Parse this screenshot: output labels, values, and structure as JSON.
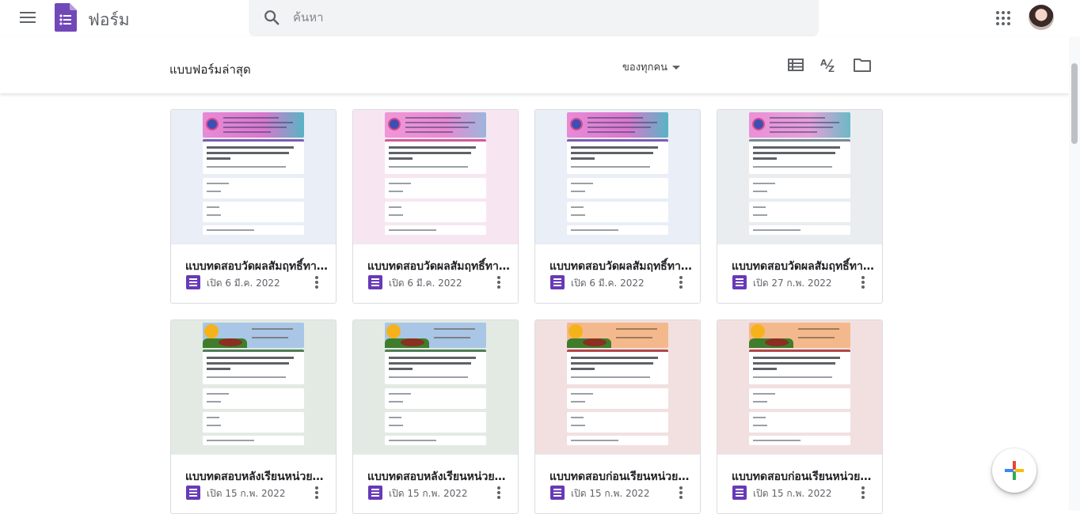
{
  "topbar": {
    "app_name": "ฟอร์ม",
    "menu_icon": "hamburger-menu-icon",
    "logo_icon": "google-forms-logo",
    "search_placeholder": "ค้นหา",
    "search_value": "",
    "apps_icon": "apps-grid-icon",
    "avatar_icon": "user-avatar"
  },
  "subbar": {
    "title": "แบบฟอร์มล่าสุด",
    "owner_filter": "ของทุกคน",
    "tools": [
      "list-view-icon",
      "sort-az-icon",
      "folder-icon"
    ]
  },
  "colors": {
    "forms_purple": "#673ab7",
    "pink_theme": "#f3e5f0",
    "blue_theme": "#e8eef7",
    "green_theme": "#e5ebe5",
    "rose_theme": "#f2e2e2"
  },
  "cards": [
    {
      "title": "แบบทดสอบวัดผลสัมฤทธิ์ทาง...",
      "date": "เปิด 6 มี.ค. 2022",
      "theme": "blue",
      "style": "school"
    },
    {
      "title": "แบบทดสอบวัดผลสัมฤทธิ์ทาง...",
      "date": "เปิด 6 มี.ค. 2022",
      "theme": "pink",
      "style": "school"
    },
    {
      "title": "แบบทดสอบวัดผลสัมฤทธิ์ทาง...",
      "date": "เปิด 6 มี.ค. 2022",
      "theme": "blue",
      "style": "school"
    },
    {
      "title": "แบบทดสอบวัดผลสัมฤทธิ์ทาง...",
      "date": "เปิด 27 ก.พ. 2022",
      "theme": "grey",
      "style": "school"
    },
    {
      "title": "แบบทดสอบหลังเรียนหน่วยที่ ...",
      "date": "เปิด 15 ก.พ. 2022",
      "theme": "green",
      "style": "garden"
    },
    {
      "title": "แบบทดสอบหลังเรียนหน่วยที่ ...",
      "date": "เปิด 15 ก.พ. 2022",
      "theme": "green",
      "style": "garden"
    },
    {
      "title": "แบบทดสอบก่อนเรียนหน่วยที่ ...",
      "date": "เปิด 15 ก.พ. 2022",
      "theme": "rose",
      "style": "garden"
    },
    {
      "title": "แบบทดสอบก่อนเรียนหน่วยที่ ...",
      "date": "เปิด 15 ก.พ. 2022",
      "theme": "rose",
      "style": "garden"
    }
  ],
  "fab": {
    "icon": "create-plus-icon"
  }
}
